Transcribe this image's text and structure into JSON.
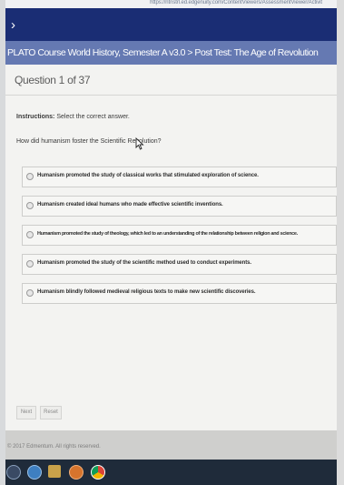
{
  "browser": {
    "url": "https://ntnstrl.ed.edgenuity.com/ContentViewers/AssessmentViewer/Activit"
  },
  "header": {
    "back_glyph": "›",
    "course_title": "PLATO Course World History, Semester A v3.0 > Post Test: The Age of Revolution"
  },
  "question": {
    "counter": "Question 1 of 37",
    "instructions_label": "Instructions:",
    "instructions_text": " Select the correct answer.",
    "prompt": "How did humanism foster the Scientific Revolution?",
    "options": [
      "Humanism promoted the study of classical works that stimulated exploration of science.",
      "Humanism created ideal humans who made effective scientific inventions.",
      "Humanism promoted the study of theology, which led to an understanding of the relationship between religion and science.",
      "Humanism promoted the study of the scientific method used to conduct experiments.",
      "Humanism blindly followed medieval religious texts to make new scientific discoveries."
    ]
  },
  "buttons": {
    "next": "Next",
    "reset": "Reset"
  },
  "footer": {
    "copyright": "© 2017 Edmentum. All rights reserved."
  },
  "taskbar": {
    "icons": [
      "windows-start-icon",
      "internet-explorer-icon",
      "file-explorer-icon",
      "media-player-icon",
      "chrome-icon"
    ]
  },
  "colors": {
    "topbar": "#1a2d74",
    "course_bar": "#6579b2",
    "panel": "#f3f3f1",
    "taskbar": "#1f2b3a"
  }
}
